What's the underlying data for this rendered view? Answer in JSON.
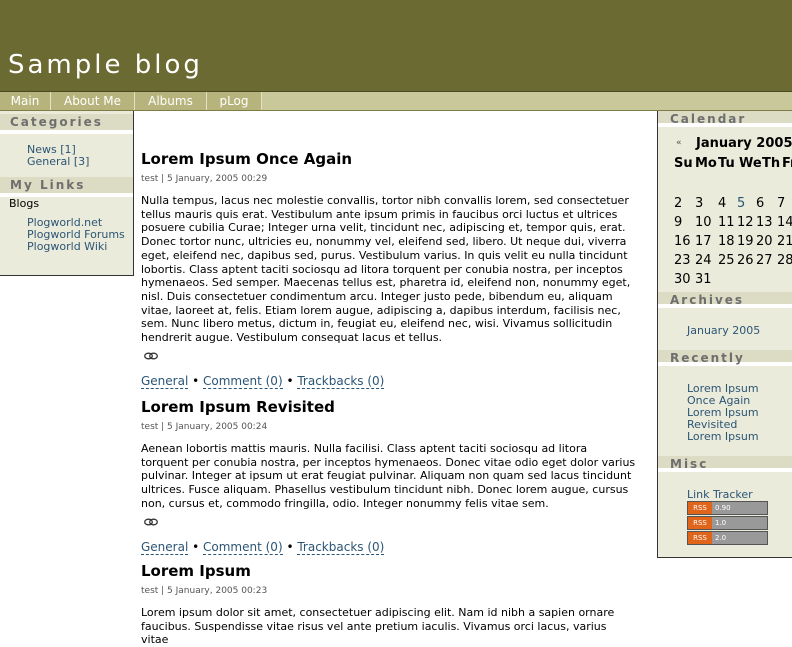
{
  "site": {
    "title": "Sample blog"
  },
  "nav": [
    "Main",
    "About Me",
    "Albums",
    "pLog"
  ],
  "left": {
    "categories_heading": "Categories",
    "categories": [
      "News [1]",
      "General [3]"
    ],
    "links_heading": "My Links",
    "links_group": "Blogs",
    "links": [
      "Plogworld.net",
      "Plogworld Forums",
      "Plogworld Wiki"
    ]
  },
  "right": {
    "calendar_heading": "Calendar",
    "calendar": {
      "prev": "«",
      "month": "January 2005",
      "weekdays": [
        "Su",
        "Mo",
        "Tu",
        "We",
        "Th",
        "Fr"
      ],
      "weeks": [
        [
          "2",
          "3",
          "4",
          "5",
          "6",
          "7"
        ],
        [
          "9",
          "10",
          "11",
          "12",
          "13",
          "14"
        ],
        [
          "16",
          "17",
          "18",
          "19",
          "20",
          "21"
        ],
        [
          "23",
          "24",
          "25",
          "26",
          "27",
          "28"
        ],
        [
          "30",
          "31"
        ]
      ]
    },
    "archives_heading": "Archives",
    "archives": [
      "January 2005"
    ],
    "recently_heading": "Recently",
    "recent": [
      "Lorem Ipsum Once Again",
      "Lorem Ipsum Revisited",
      "Lorem Ipsum"
    ],
    "misc_heading": "Misc",
    "misc_link": "Link Tracker",
    "rss": [
      {
        "tag": "RSS",
        "version": "0.90"
      },
      {
        "tag": "RSS",
        "version": "1.0"
      },
      {
        "tag": "RSS",
        "version": "2.0"
      }
    ]
  },
  "posts": [
    {
      "title": "Lorem Ipsum Once Again",
      "meta": "test | 5 January, 2005 00:29",
      "body": "Nulla tempus, lacus nec molestie convallis, tortor nibh convallis lorem, sed consectetuer tellus mauris quis erat. Vestibulum ante ipsum primis in faucibus orci luctus et ultrices posuere cubilia Curae; Integer urna velit, tincidunt nec, adipiscing et, tempor quis, erat. Donec tortor nunc, ultricies eu, nonummy vel, eleifend sed, libero. Ut neque dui, viverra eget, eleifend nec, dapibus sed, purus. Vestibulum varius. In quis velit eu nulla tincidunt lobortis. Class aptent taciti sociosqu ad litora torquent per conubia nostra, per inceptos hymenaeos. Sed semper. Maecenas tellus est, pharetra id, eleifend non, nonummy eget, nisl. Duis consectetuer condimentum arcu. Integer justo pede, bibendum eu, aliquam vitae, laoreet at, felis. Etiam lorem augue, adipiscing a, dapibus interdum, facilisis nec, sem. Nunc libero metus, dictum in, feugiat eu, eleifend nec, wisi. Vivamus sollicitudin hendrerit augue. Vestibulum consequat lacus et tellus.",
      "category": "General",
      "comments": "Comment (0)",
      "trackbacks": "Trackbacks (0)"
    },
    {
      "title": "Lorem Ipsum Revisited",
      "meta": "test | 5 January, 2005 00:24",
      "body": "Aenean lobortis mattis mauris. Nulla facilisi. Class aptent taciti sociosqu ad litora torquent per conubia nostra, per inceptos hymenaeos. Donec vitae odio eget dolor varius pulvinar. Integer at ipsum ut erat feugiat pulvinar. Aliquam non quam sed lacus tincidunt ultrices. Fusce aliquam. Phasellus vestibulum tincidunt nibh. Donec lorem augue, cursus non, cursus et, commodo fringilla, odio. Integer nonummy felis vitae sem.",
      "category": "General",
      "comments": "Comment (0)",
      "trackbacks": "Trackbacks (0)"
    },
    {
      "title": "Lorem Ipsum",
      "meta": "test | 5 January, 2005 00:23",
      "body": "Lorem ipsum dolor sit amet, consectetuer adipiscing elit. Nam id nibh a sapien ornare faucibus. Suspendisse vitae risus vel ante pretium iaculis. Vivamus orci lacus, varius vitae"
    }
  ],
  "separator": " • "
}
